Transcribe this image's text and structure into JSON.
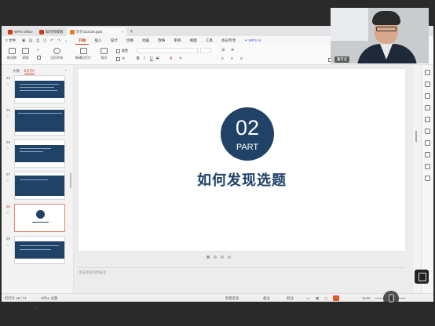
{
  "titlebar": {
    "tabs": [
      {
        "label": "WPS Office",
        "color": "#c93a1a"
      },
      {
        "label": "如何找模板",
        "color": "#c93a1a"
      },
      {
        "label": "写什么0228.pptx",
        "color": "#e67e22"
      }
    ],
    "add": "+",
    "tab_close": "×"
  },
  "menubar": {
    "file": "≡ 文件",
    "items": [
      "开始",
      "插入",
      "设计",
      "切换",
      "动画",
      "放映",
      "审阅",
      "视图",
      "工具",
      "会员专享"
    ],
    "ai": "WPS AI"
  },
  "ribbon": {
    "format_painter": "格式刷",
    "paste": "粘贴",
    "play_from_current": "当页开始",
    "new_slide": "新建幻灯片",
    "layout": "版式",
    "section": "节",
    "reset": "重置",
    "textbox": "文本框",
    "arrange": "排列",
    "shape_label": "形状"
  },
  "leftpane": {
    "tabs": [
      "大纲",
      "幻灯片"
    ],
    "thumbs": [
      {
        "num": "24"
      },
      {
        "num": "25"
      },
      {
        "num": "26"
      },
      {
        "num": "27"
      },
      {
        "num": "28"
      },
      {
        "num": "29"
      }
    ],
    "add": "+"
  },
  "slide": {
    "number": "02",
    "part": "PART",
    "title": "如何发现选题"
  },
  "notes_placeholder": "单击此处添加备注",
  "statusbar": {
    "slide_count": "幻灯片 28 / 71",
    "theme": "Office 主题",
    "smart_beautify": "智能美化",
    "notes": "备注",
    "comments": "批注",
    "zoom": "114%"
  },
  "webcam": {
    "name": "董可武"
  },
  "colors": {
    "accent": "#c93a1a",
    "navy": "#1f4266"
  }
}
